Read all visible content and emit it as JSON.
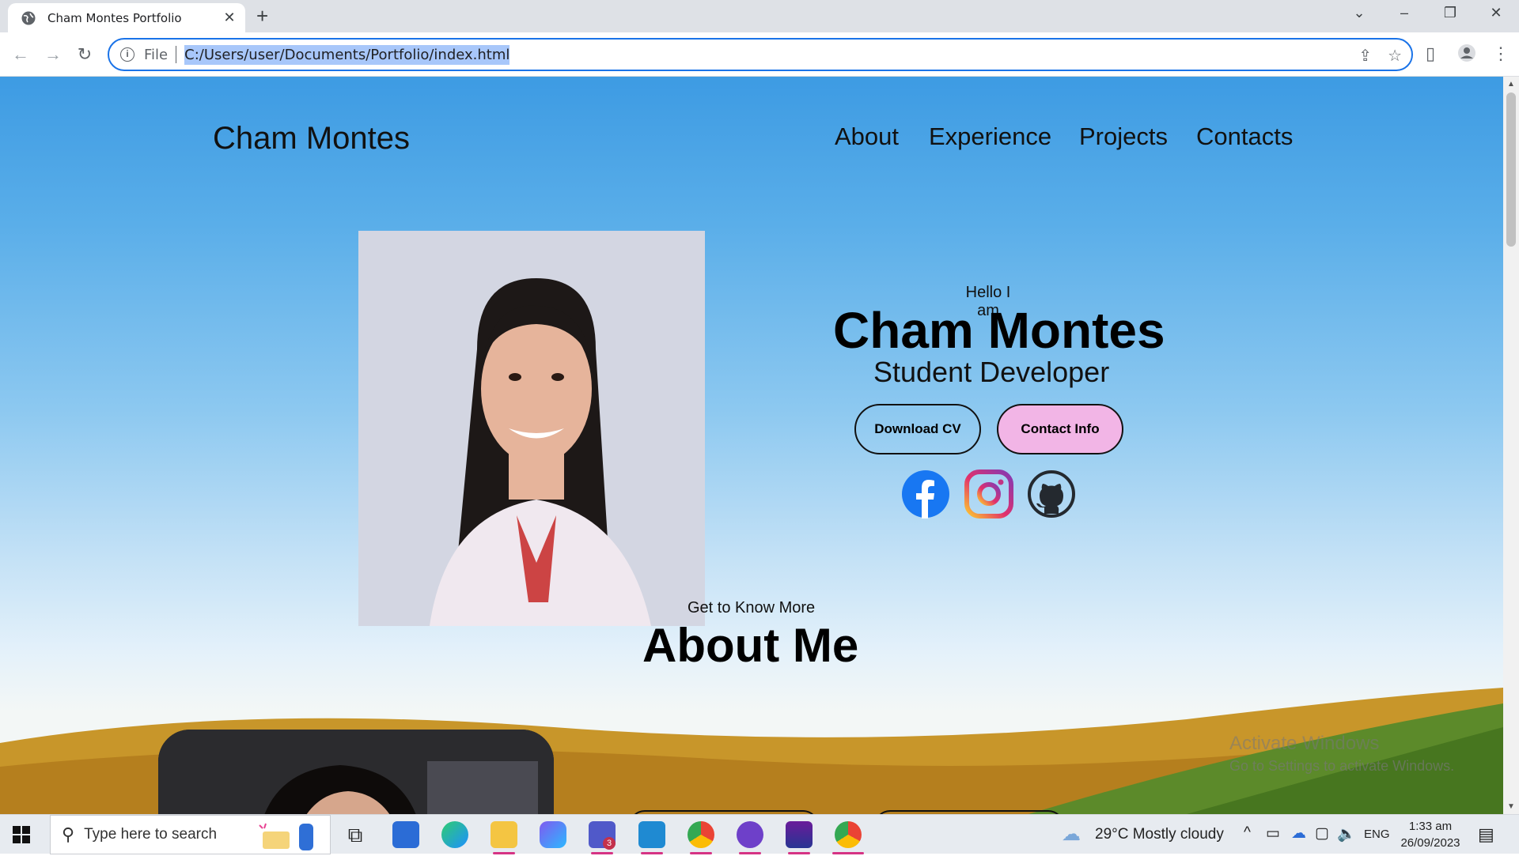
{
  "browser": {
    "tab_title": "Cham Montes Portfolio",
    "new_tab": "+",
    "omnibox_scheme": "File",
    "url": "C:/Users/user/Documents/Portfolio/index.html"
  },
  "page": {
    "brand": "Cham Montes",
    "nav": [
      "About",
      "Experience",
      "Projects",
      "Contacts"
    ],
    "hero": {
      "greeting": "Hello I am",
      "name": "Cham Montes",
      "role": "Student Developer",
      "download_cv": "Download CV",
      "contact_info": "Contact Info"
    },
    "social": [
      "facebook-icon",
      "instagram-icon",
      "github-icon"
    ],
    "about": {
      "eyebrow": "Get to Know More",
      "title": "About Me"
    },
    "watermark": {
      "line1": "Activate Windows",
      "line2": "Go to Settings to activate Windows."
    }
  },
  "taskbar": {
    "search_placeholder": "Type here to search",
    "weather": "29°C  Mostly cloudy",
    "language": "ENG",
    "time": "1:33 am",
    "date": "26/09/2023",
    "teams_badge": "3"
  },
  "colors": {
    "omnibox_focus": "#1a73e8",
    "contact_button": "#f2b5e6",
    "facebook": "#1877f2"
  }
}
